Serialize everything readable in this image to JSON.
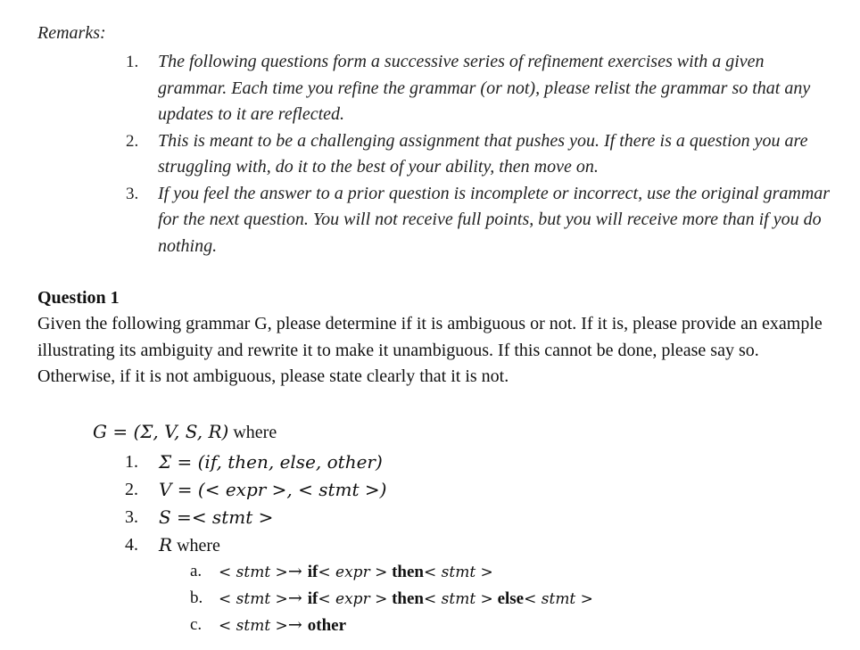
{
  "remarks": {
    "title": "Remarks:",
    "items": [
      {
        "number": "1.",
        "text": "The following questions form a successive series of refinement exercises with a given grammar. Each time you refine the grammar (or not), please relist the grammar so that any updates to it are reflected."
      },
      {
        "number": "2.",
        "text": "This is meant to be a challenging assignment that pushes you. If there is a question you are struggling with, do it to the best of your ability, then move on."
      },
      {
        "number": "3.",
        "text": "If you feel the answer to a prior question is incomplete or incorrect, use the original grammar for the next question. You will not receive full points, but you will receive more than if you do nothing."
      }
    ]
  },
  "question": {
    "title": "Question 1",
    "body": "Given the following grammar G, please determine if it is ambiguous or not. If it is, please provide an example illustrating its ambiguity and rewrite it to make it unambiguous. If this cannot be done, please say so. Otherwise, if it is not ambiguous, please state clearly that it is not."
  },
  "grammar": {
    "definition_math": "G = (Σ, V, S, R)",
    "definition_suffix": " where",
    "items": [
      {
        "number": "1.",
        "math": "Σ = (if, then, else, other)"
      },
      {
        "number": "2.",
        "math": "V = (< expr >,  < stmt >)"
      },
      {
        "number": "3.",
        "math": "S =< stmt >"
      },
      {
        "number": "4.",
        "math": "R",
        "suffix": " where"
      }
    ],
    "rules": [
      {
        "letter": "a.",
        "parts": [
          {
            "t": "nt",
            "v": "< stmt >"
          },
          {
            "t": "op",
            "v": "→ "
          },
          {
            "t": "kw",
            "v": "if"
          },
          {
            "t": "nt",
            "v": "< expr >"
          },
          {
            "t": "kw",
            "v": " then"
          },
          {
            "t": "nt",
            "v": "< stmt >"
          }
        ]
      },
      {
        "letter": "b.",
        "parts": [
          {
            "t": "nt",
            "v": "< stmt >"
          },
          {
            "t": "op",
            "v": "→ "
          },
          {
            "t": "kw",
            "v": "if"
          },
          {
            "t": "nt",
            "v": "< expr >"
          },
          {
            "t": "kw",
            "v": " then"
          },
          {
            "t": "nt",
            "v": "< stmt >"
          },
          {
            "t": "kw",
            "v": " else"
          },
          {
            "t": "nt",
            "v": "< stmt >"
          }
        ]
      },
      {
        "letter": "c.",
        "parts": [
          {
            "t": "nt",
            "v": "< stmt >"
          },
          {
            "t": "op",
            "v": "→ "
          },
          {
            "t": "kw",
            "v": "other"
          }
        ]
      }
    ]
  }
}
